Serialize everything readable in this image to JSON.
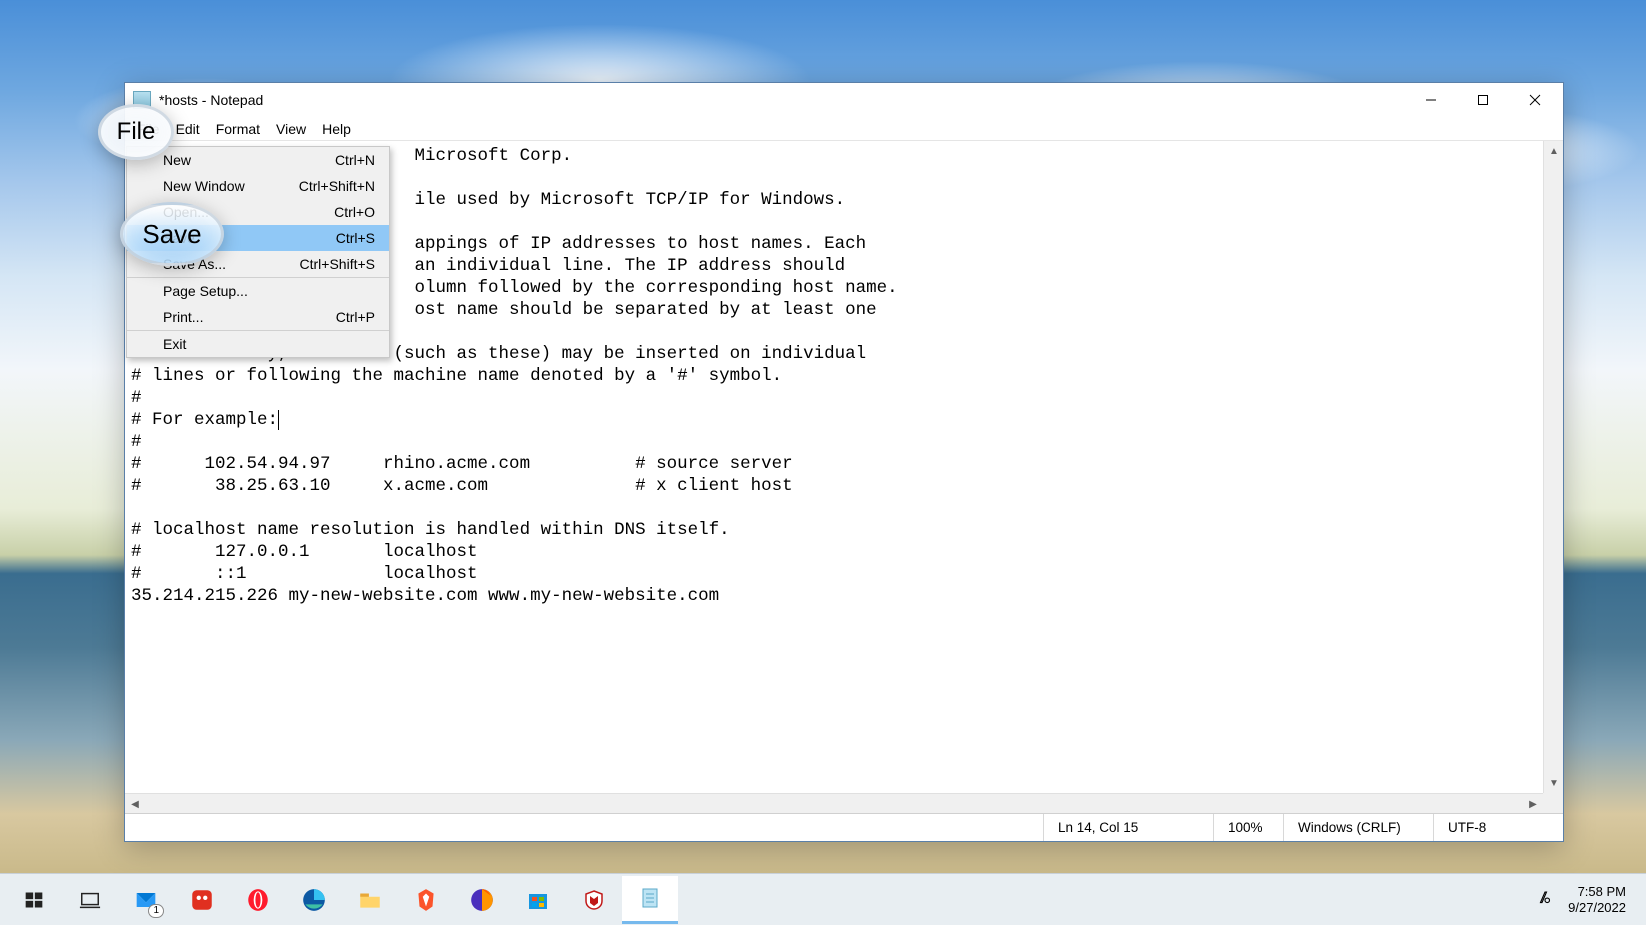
{
  "window": {
    "title": "*hosts - Notepad",
    "menus": {
      "file": "File",
      "edit": "Edit",
      "format": "Format",
      "view": "View",
      "help": "Help"
    }
  },
  "file_menu": {
    "items": [
      {
        "label": "New",
        "shortcut": "Ctrl+N"
      },
      {
        "label": "New Window",
        "shortcut": "Ctrl+Shift+N"
      },
      {
        "label": "Open...",
        "shortcut": "Ctrl+O"
      },
      {
        "label": "Save",
        "shortcut": "Ctrl+S",
        "highlighted": true
      },
      {
        "label": "Save As...",
        "shortcut": "Ctrl+Shift+S"
      },
      {
        "label": "Page Setup...",
        "shortcut": ""
      },
      {
        "label": "Print...",
        "shortcut": "Ctrl+P"
      },
      {
        "label": "Exit",
        "shortcut": ""
      }
    ]
  },
  "callouts": {
    "file_label": "File",
    "save_label": "Save"
  },
  "editor": {
    "visible_text_right": "Microsoft Corp.\n\nile used by Microsoft TCP/IP for Windows.\n\nappings of IP addresses to host names. Each\nan individual line. The IP address should\nolumn followed by the corresponding host name.\nost name should be separated by at least one",
    "body_lines": [
      "# Additionally, comments (such as these) may be inserted on individual",
      "# lines or following the machine name denoted by a '#' symbol.",
      "#",
      "# For example:",
      "#",
      "#      102.54.94.97     rhino.acme.com          # source server",
      "#       38.25.63.10     x.acme.com              # x client host",
      "",
      "# localhost name resolution is handled within DNS itself.",
      "#       127.0.0.1       localhost",
      "#       ::1             localhost",
      "35.214.215.226 my-new-website.com www.my-new-website.com"
    ]
  },
  "status": {
    "position": "Ln 14, Col 15",
    "zoom": "100%",
    "line_ending": "Windows (CRLF)",
    "encoding": "UTF-8"
  },
  "taskbar": {
    "mail_badge": "1",
    "time": "7:58 PM",
    "date": "9/27/2022"
  }
}
